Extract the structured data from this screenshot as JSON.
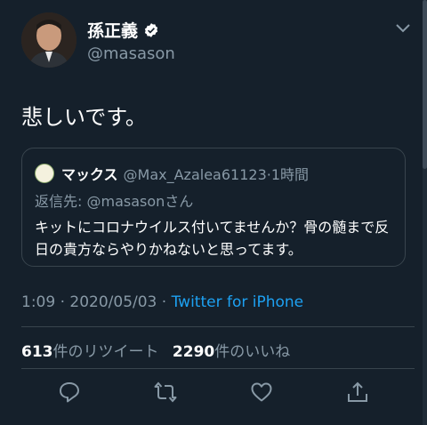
{
  "user": {
    "name": "孫正義",
    "handle": "@masason"
  },
  "tweet": {
    "text": "悲しいです。",
    "time": "1:09 · 2020/05/03 · ",
    "source": "Twitter for iPhone"
  },
  "quote": {
    "name": "マックス",
    "handle": "@Max_Azalea61123·1時間",
    "reply_prefix": "返信先: ",
    "reply_mention": "@masasonさん",
    "body": "キットにコロナウイルス付いてませんか？骨の髄まで反日の貴方ならやりかねないと思ってます。"
  },
  "stats": {
    "retweets_count": "613",
    "retweets_label": "件のリツイート",
    "likes_count": "2290",
    "likes_label": "件のいいね"
  },
  "icons": {
    "verified": "verified-badge-icon",
    "menu": "chevron-down-icon",
    "reply": "reply-icon",
    "retweet": "retweet-icon",
    "like": "heart-icon",
    "share": "share-icon"
  },
  "colors": {
    "background": "#15202b",
    "secondary_text": "#8899a6",
    "accent": "#1da1f2",
    "border": "#38444d"
  }
}
